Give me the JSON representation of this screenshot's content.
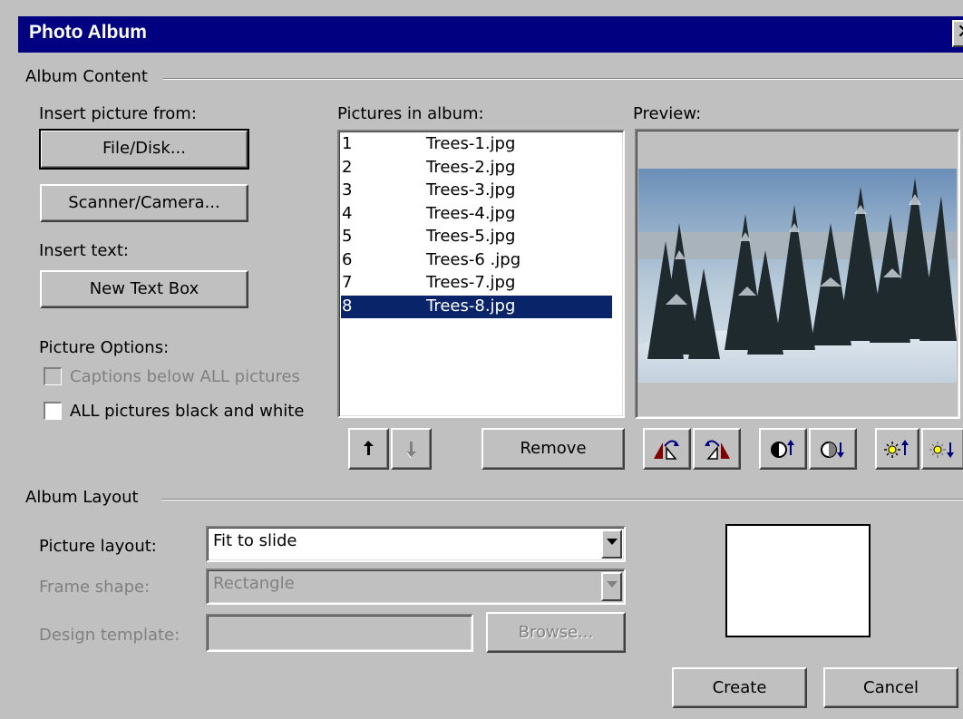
{
  "window": {
    "title": "Photo Album"
  },
  "album_content": {
    "group_label": "Album Content",
    "insert_picture_label": "Insert picture from:",
    "file_disk_button": "File/Disk...",
    "scanner_camera_button": "Scanner/Camera...",
    "insert_text_label": "Insert text:",
    "new_text_box_button": "New Text Box",
    "picture_options_label": "Picture Options:",
    "captions_checkbox_label": "Captions below ALL pictures",
    "captions_checked": false,
    "bw_checkbox_label": "ALL pictures black and white",
    "bw_checked": false,
    "pictures_label": "Pictures in album:",
    "pictures": [
      {
        "num": "1",
        "name": "Trees-1.jpg"
      },
      {
        "num": "2",
        "name": "Trees-2.jpg"
      },
      {
        "num": "3",
        "name": "Trees-3.jpg"
      },
      {
        "num": "4",
        "name": "Trees-4.jpg"
      },
      {
        "num": "5",
        "name": "Trees-5.jpg"
      },
      {
        "num": "6",
        "name": "Trees-6 .jpg"
      },
      {
        "num": "7",
        "name": "Trees-7.jpg"
      },
      {
        "num": "8",
        "name": "Trees-8.jpg"
      }
    ],
    "selected_index": 7,
    "move_up_icon": "arrow-up-icon",
    "move_down_icon": "arrow-down-icon",
    "remove_button": "Remove",
    "preview_label": "Preview:",
    "preview_tools": [
      "rotate-left-icon",
      "rotate-right-icon",
      "contrast-up-icon",
      "contrast-down-icon",
      "brightness-up-icon",
      "brightness-down-icon"
    ]
  },
  "album_layout": {
    "group_label": "Album Layout",
    "picture_layout_label": "Picture layout:",
    "picture_layout_value": "Fit to slide",
    "frame_shape_label": "Frame shape:",
    "frame_shape_value": "Rectangle",
    "design_template_label": "Design template:",
    "design_template_value": "",
    "browse_button": "Browse..."
  },
  "footer": {
    "create_button": "Create",
    "cancel_button": "Cancel"
  },
  "colors": {
    "title_bar": "#000080",
    "face": "#c0c0c0",
    "selection": "#0a246a"
  }
}
